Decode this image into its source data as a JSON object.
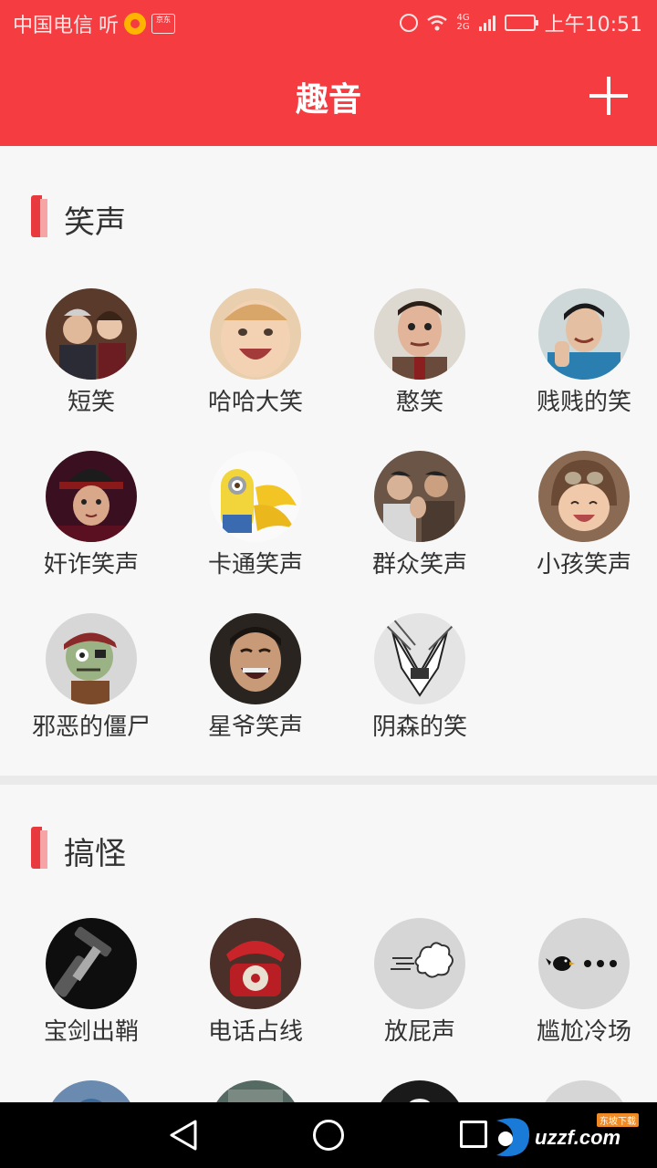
{
  "status_bar": {
    "carrier": "中国电信",
    "ting_label": "听",
    "jd_badge": "京东",
    "network": "4G",
    "network2": "2G",
    "time": "上午10:51"
  },
  "header": {
    "title": "趣音",
    "add_icon": "plus-icon"
  },
  "sections": [
    {
      "title": "笑声",
      "items": [
        {
          "label": "短笑",
          "image": "couple-laughing-photo"
        },
        {
          "label": "哈哈大笑",
          "image": "laughing-baby-photo"
        },
        {
          "label": "憨笑",
          "image": "mr-bean-photo"
        },
        {
          "label": "贱贱的笑",
          "image": "young-man-photo"
        },
        {
          "label": "奸诈笑声",
          "image": "emperor-child-photo"
        },
        {
          "label": "卡通笑声",
          "image": "minion-bananas-photo"
        },
        {
          "label": "群众笑声",
          "image": "crowd-clapping-photo"
        },
        {
          "label": "小孩笑声",
          "image": "baby-aviator-hat-photo"
        },
        {
          "label": "邪恶的僵尸",
          "image": "pirate-zombie-cartoon"
        },
        {
          "label": "星爷笑声",
          "image": "stephen-chow-laughing-photo"
        },
        {
          "label": "阴森的笑",
          "image": "manga-character-drawing"
        }
      ]
    },
    {
      "title": "搞怪",
      "items": [
        {
          "label": "宝剑出鞘",
          "image": "sword-hilt-photo"
        },
        {
          "label": "电话占线",
          "image": "red-rotary-phone-photo"
        },
        {
          "label": "放屁声",
          "image": "fart-cloud-icon"
        },
        {
          "label": "尴尬冷场",
          "image": "crow-ellipsis-icon"
        },
        {
          "label": "",
          "image": "partial-photo"
        },
        {
          "label": "",
          "image": "partial-photo"
        },
        {
          "label": "",
          "image": "partial-dark-icon"
        },
        {
          "label": "",
          "image": "partial-gray-icon"
        }
      ]
    }
  ],
  "nav_bar": {
    "back_icon": "back-triangle-icon",
    "home_icon": "home-circle-icon",
    "recent_icon": "recent-square-icon",
    "watermark": "uzzf.com",
    "watermark_small": "东坡下载"
  },
  "colors": {
    "accent": "#f53c41",
    "section_bar": "#e83a3e",
    "section_bar_light": "#f7a4a6",
    "background": "#f7f7f7",
    "text": "#333333"
  }
}
